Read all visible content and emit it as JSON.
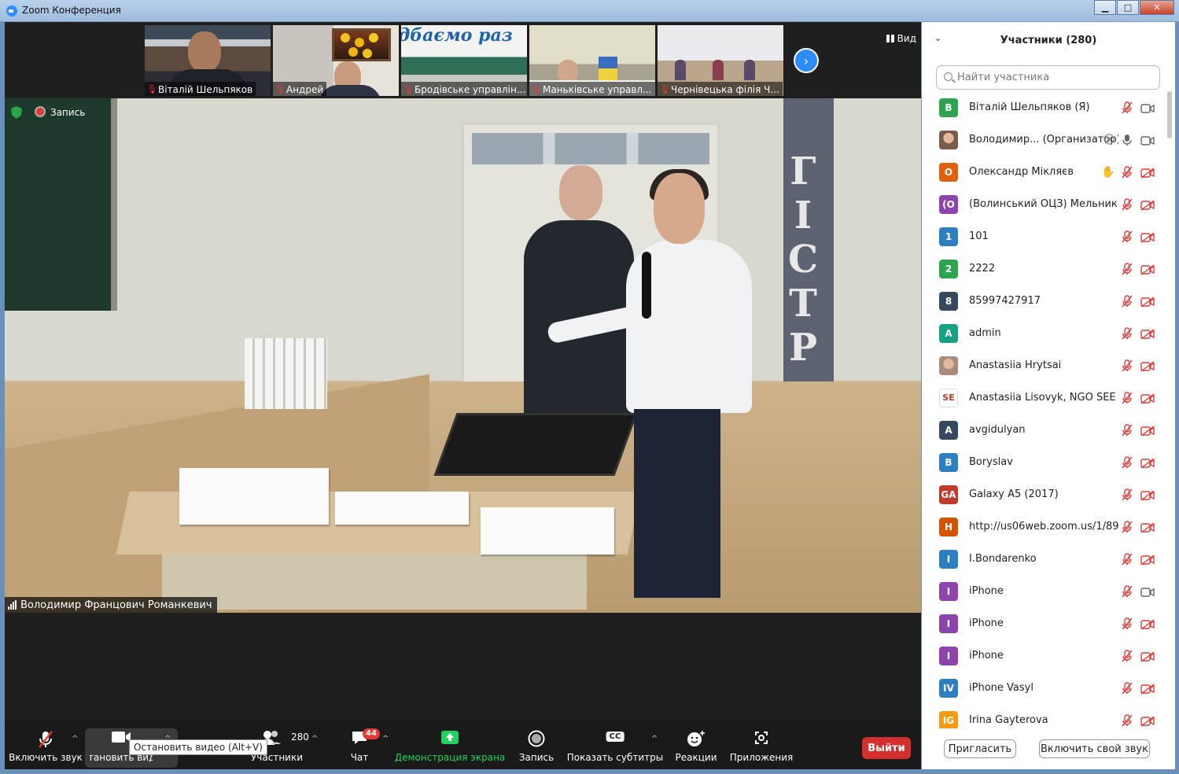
{
  "window": {
    "title": "Zoom Конференция",
    "min": "▁",
    "max": "□",
    "close": "✕"
  },
  "thumbnails": [
    {
      "name": "Віталій Шельпяков"
    },
    {
      "name": "Андрей"
    },
    {
      "name": "Бродівське управлін..."
    },
    {
      "name": "Маньківське управл..."
    },
    {
      "name": "Чернівецька філія Ч..."
    }
  ],
  "thumb3_banner": "дбаємо раз",
  "view_label": "Вид",
  "status": {
    "record_label": "Запись"
  },
  "video": {
    "banner_text": "ГІСТР"
  },
  "speaker": {
    "name": "Володимир Францович Романкевич"
  },
  "toolbar": {
    "audio": "Включить звук",
    "video": "Остановить видео",
    "participants": "Участники",
    "participants_count": "280",
    "chat": "Чат",
    "chat_badge": "44",
    "share": "Демонстрация экрана",
    "record": "Запись",
    "captions": "Показать субтитры",
    "cc": "CC",
    "reactions": "Реакции",
    "apps": "Приложения",
    "leave": "Выйти",
    "tooltip": "Остановить видео (Alt+V)"
  },
  "panel": {
    "title": "Участники (280)",
    "search_placeholder": "Найти участника",
    "invite": "Пригласить",
    "unmute_self": "Включить свой звук"
  },
  "participants": [
    {
      "initials": "В",
      "name": "Віталій Шельпяков (Я)",
      "color": "#2ea44f",
      "cam": "on"
    },
    {
      "initials": "",
      "name": "Володимир... (Организатор)",
      "color": "#7a5a48",
      "photo": true,
      "mic": "on",
      "cam": "on",
      "extra": "record"
    },
    {
      "initials": "О",
      "name": "Олександр Мікляєв",
      "color": "#e0600e",
      "extra": "hand"
    },
    {
      "initials": "(О",
      "name": "(Волинський ОЦЗ) Мельник Р...",
      "color": "#8e44ad"
    },
    {
      "initials": "1",
      "name": "101",
      "color": "#2d7fc1"
    },
    {
      "initials": "2",
      "name": "2222",
      "color": "#2ea44f"
    },
    {
      "initials": "8",
      "name": "85997427917",
      "color": "#34495e"
    },
    {
      "initials": "A",
      "name": "admin",
      "color": "#16a085"
    },
    {
      "initials": "",
      "name": "Anastasiia Hrytsai",
      "color": "#a98b7b",
      "photo": true
    },
    {
      "initials": "SE",
      "name": "Anastasiia Lisovyk, NGO SEE",
      "color": "#ffffff",
      "logo": true
    },
    {
      "initials": "A",
      "name": "avgidulyan",
      "color": "#34495e"
    },
    {
      "initials": "B",
      "name": "Boryslav",
      "color": "#2d7fc1"
    },
    {
      "initials": "GA",
      "name": "Galaxy A5 (2017)",
      "color": "#c0392b"
    },
    {
      "initials": "H",
      "name": "http://us06web.zoom.us/1/892...",
      "color": "#d35400"
    },
    {
      "initials": "I",
      "name": "I.Bondarenko",
      "color": "#2d7fc1"
    },
    {
      "initials": "I",
      "name": "iPhone",
      "color": "#8e44ad",
      "cam": "on"
    },
    {
      "initials": "I",
      "name": "iPhone",
      "color": "#8e44ad"
    },
    {
      "initials": "I",
      "name": "iPhone",
      "color": "#8e44ad"
    },
    {
      "initials": "IV",
      "name": "iPhone Vasyl",
      "color": "#2d7fc1"
    },
    {
      "initials": "IG",
      "name": "Irina Gayterova",
      "color": "#f39c12"
    }
  ]
}
